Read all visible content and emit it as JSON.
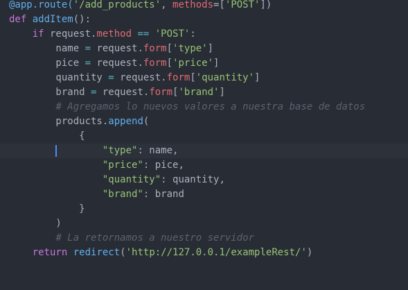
{
  "editor": {
    "language": "python",
    "active_line": 10,
    "colors": {
      "background": "#282c34",
      "active_line_background": "#2c313a",
      "cursor": "#528bff",
      "plain": "#abb2bf",
      "keyword": "#c678dd",
      "function": "#61afef",
      "string": "#98c379",
      "attribute": "#e06c75",
      "operator": "#56b6c2",
      "comment": "#5c6370"
    },
    "lines": [
      [
        [
          "@app.route(",
          "function"
        ],
        [
          "'/add_products'",
          "string"
        ],
        [
          ", ",
          "plain"
        ],
        [
          "methods",
          "attribute"
        ],
        [
          "=[",
          "plain"
        ],
        [
          "'POST'",
          "string"
        ],
        [
          "])",
          "plain"
        ]
      ],
      [
        [
          "def ",
          "keyword"
        ],
        [
          "addItem",
          "function"
        ],
        [
          "():",
          "plain"
        ]
      ],
      [
        [
          "    ",
          "plain"
        ],
        [
          "if",
          "keyword"
        ],
        [
          " request.",
          "plain"
        ],
        [
          "method",
          "attribute"
        ],
        [
          " == ",
          "operator"
        ],
        [
          "'POST'",
          "string"
        ],
        [
          ":",
          "plain"
        ]
      ],
      [
        [
          "        name ",
          "plain"
        ],
        [
          "=",
          "operator"
        ],
        [
          " request.",
          "plain"
        ],
        [
          "form",
          "attribute"
        ],
        [
          "[",
          "plain"
        ],
        [
          "'type'",
          "string"
        ],
        [
          "]",
          "plain"
        ]
      ],
      [
        [
          "        pice ",
          "plain"
        ],
        [
          "=",
          "operator"
        ],
        [
          " request.",
          "plain"
        ],
        [
          "form",
          "attribute"
        ],
        [
          "[",
          "plain"
        ],
        [
          "'price'",
          "string"
        ],
        [
          "]",
          "plain"
        ]
      ],
      [
        [
          "        quantity ",
          "plain"
        ],
        [
          "=",
          "operator"
        ],
        [
          " request.",
          "plain"
        ],
        [
          "form",
          "attribute"
        ],
        [
          "[",
          "plain"
        ],
        [
          "'quantity'",
          "string"
        ],
        [
          "]",
          "plain"
        ]
      ],
      [
        [
          "        brand ",
          "plain"
        ],
        [
          "=",
          "operator"
        ],
        [
          " request.",
          "plain"
        ],
        [
          "form",
          "attribute"
        ],
        [
          "[",
          "plain"
        ],
        [
          "'brand'",
          "string"
        ],
        [
          "]",
          "plain"
        ]
      ],
      [
        [
          "        ",
          "plain"
        ],
        [
          "# Agregamos lo nuevos valores a nuestra base de datos",
          "comment"
        ]
      ],
      [
        [
          "        products.",
          "plain"
        ],
        [
          "append",
          "function"
        ],
        [
          "(",
          "plain"
        ]
      ],
      [
        [
          "            {",
          "plain"
        ]
      ],
      [
        [
          "                ",
          "plain"
        ],
        [
          "\"type\"",
          "string"
        ],
        [
          ": name,",
          "plain"
        ]
      ],
      [
        [
          "                ",
          "plain"
        ],
        [
          "\"price\"",
          "string"
        ],
        [
          ": pice,",
          "plain"
        ]
      ],
      [
        [
          "                ",
          "plain"
        ],
        [
          "\"quantity\"",
          "string"
        ],
        [
          ": quantity,",
          "plain"
        ]
      ],
      [
        [
          "                ",
          "plain"
        ],
        [
          "\"brand\"",
          "string"
        ],
        [
          ": brand",
          "plain"
        ]
      ],
      [
        [
          "            }",
          "plain"
        ]
      ],
      [
        [
          "        )",
          "plain"
        ]
      ],
      [
        [
          "        ",
          "plain"
        ],
        [
          "# La retornamos a nuestro servidor",
          "comment"
        ]
      ],
      [
        [
          "    ",
          "plain"
        ],
        [
          "return",
          "keyword"
        ],
        [
          " ",
          "plain"
        ],
        [
          "redirect",
          "function"
        ],
        [
          "(",
          "plain"
        ],
        [
          "'http://127.0.0.1/exampleRest/'",
          "string"
        ],
        [
          ")",
          "plain"
        ]
      ]
    ]
  }
}
